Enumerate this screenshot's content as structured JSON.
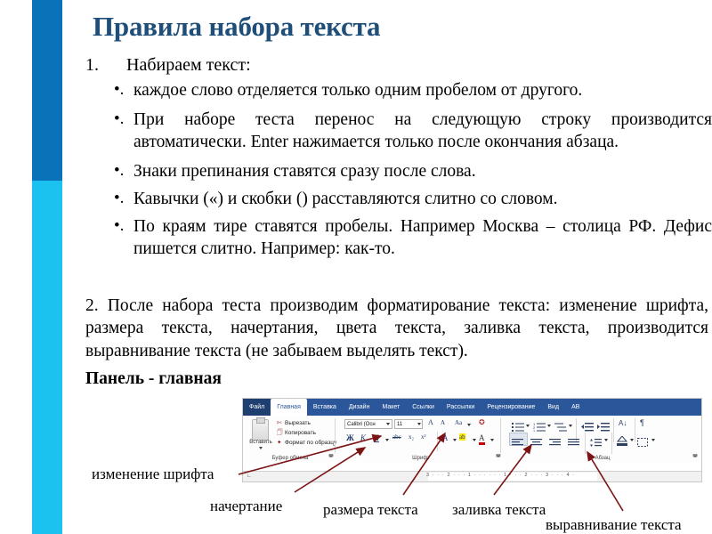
{
  "slide": {
    "title": "Правила набора текста",
    "numbered_item_1": {
      "number": "1.",
      "text": "Набираем текст:"
    },
    "bullets": [
      "каждое слово отделяется только одним пробелом от другого.",
      "При наборе теста перенос на следующую строку производится автоматически. Enter нажимается только после окончания абзаца.",
      "Знаки препинания ставятся сразу после слова.",
      "Кавычки («) и скобки () расставляются слитно со словом.",
      "По краям тире ставятся пробелы. Например Москва – столица РФ. Дефис пишется слитно. Например: как-то."
    ],
    "bullet_marker": "•.",
    "paragraph_2": "2. После набора теста производим форматирование текста: изменение шрифта, размера текста, начертания, цвета текста, заливка текста, производится выравнивание текста (не забываем выделять текст).",
    "panel_label": "Панель - главная"
  },
  "colors": {
    "sidebar_top": "#0a72b8",
    "sidebar_bottom": "#1bc2f0",
    "title": "#1f4e79",
    "arrow": "#7b1214",
    "ribbon_tabbar": "#2b579a"
  },
  "annotations": [
    {
      "label": "изменение шрифта"
    },
    {
      "label": "начертание"
    },
    {
      "label": "размера текста"
    },
    {
      "label": "заливка текста"
    },
    {
      "label": "выравнивание текста"
    }
  ],
  "ribbon": {
    "tabs": [
      {
        "label": "Файл",
        "active": false,
        "file": true
      },
      {
        "label": "Главная",
        "active": true
      },
      {
        "label": "Вставка",
        "active": false
      },
      {
        "label": "Дизайн",
        "active": false
      },
      {
        "label": "Макет",
        "active": false
      },
      {
        "label": "Ссылки",
        "active": false
      },
      {
        "label": "Рассылки",
        "active": false
      },
      {
        "label": "Рецензирование",
        "active": false
      },
      {
        "label": "Вид",
        "active": false
      },
      {
        "label": "АВ",
        "active": false
      }
    ],
    "clipboard": {
      "group_label": "Буфер обмена",
      "paste": "Вставить",
      "cut": "Вырезать",
      "copy": "Копировать",
      "format_painter": "Формат по образцу"
    },
    "font": {
      "group_label": "Шрифт",
      "font_name": "Calibri (Осн",
      "font_size": "11",
      "grow": "A",
      "shrink": "A",
      "change_case": "Aa",
      "bold": "Ж",
      "italic": "К",
      "underline": "Ч",
      "strikethrough": "abc",
      "subscript": "x₂",
      "superscript": "x²",
      "text_effects": "A",
      "highlight": "ab",
      "font_color": "A"
    },
    "paragraph": {
      "group_label": "Абзац"
    },
    "ruler_numbers": "3 · · · 2 · · · 1 · · ·   · · · 1 · · · 2 · · · 3 · · · 4 ·"
  }
}
